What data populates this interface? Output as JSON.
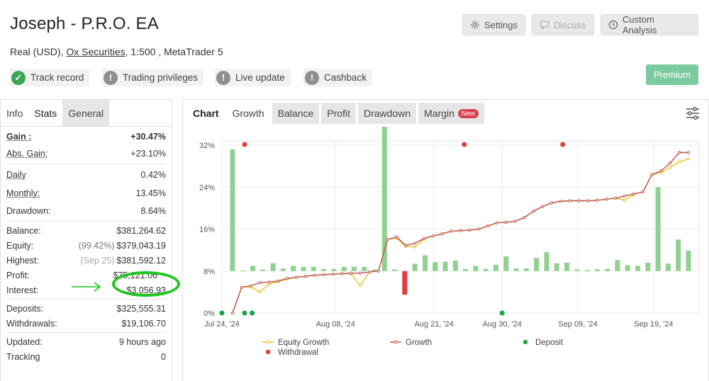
{
  "header": {
    "title": "Joseph - P.R.O. EA",
    "sub_prefix": "Real (USD),",
    "broker": "Ox Securities",
    "sub_suffix": ", 1:500 , MetaTrader 5",
    "settings": "Settings",
    "discuss": "Discuss",
    "custom_analysis": "Custom Analysis",
    "premium": "Premium"
  },
  "badges": {
    "track_record": "Track record",
    "trading_privileges": "Trading privileges",
    "live_update": "Live update",
    "cashback": "Cashback"
  },
  "left_tabs": {
    "info": "Info",
    "stats": "Stats",
    "general": "General"
  },
  "stats": {
    "gain_k": "Gain :",
    "gain_v": "+30.47%",
    "abs_gain_k": "Abs. Gain:",
    "abs_gain_v": "+23.10%",
    "daily_k": "Daily",
    "daily_v": "0.42%",
    "monthly_k": "Monthly:",
    "monthly_v": "13.45%",
    "drawdown_k": "Drawdown:",
    "drawdown_v": "8.64%",
    "balance_k": "Balance:",
    "balance_v": "$381,264.62",
    "equity_k": "Equity:",
    "equity_pre": "(99.42%)",
    "equity_v": "$379,043.19",
    "highest_k": "Highest:",
    "highest_pre": "(Sep 25)",
    "highest_v": "$381,592.12",
    "profit_k": "Profit:",
    "profit_v": "$75,121.06",
    "interest_k": "Interest:",
    "interest_v": "$3,056.93",
    "deposits_k": "Deposits:",
    "deposits_v": "$325,555.31",
    "withdrawals_k": "Withdrawals:",
    "withdrawals_v": "$19,106.70",
    "updated_k": "Updated:",
    "updated_v": "9 hours ago",
    "tracking_k": "Tracking",
    "tracking_v": "0"
  },
  "chart_tabs": {
    "chart": "Chart",
    "growth": "Growth",
    "balance": "Balance",
    "profit": "Profit",
    "drawdown": "Drawdown",
    "margin": "Margin",
    "new": "New"
  },
  "colors": {
    "growth": "#c0504d",
    "equity": "#e8c21a",
    "bar_pos": "#8fd18f",
    "bar_neg": "#e23b3b",
    "deposit": "#1aa34a",
    "withdrawal": "#e03c3c",
    "premium": "#7ccba0"
  },
  "chart_data": {
    "type": "line",
    "x_ticks": [
      "Jul 24, '24",
      "Aug 08, '24",
      "Aug 21, '24",
      "Aug 30, '24",
      "Sep 09, '24",
      "Sep 19, '24"
    ],
    "y_ticks": [
      "0%",
      "8%",
      "16%",
      "24%",
      "32%"
    ],
    "ylim": [
      0,
      32
    ],
    "legend": [
      "Equity Growth",
      "Growth",
      "Deposit",
      "Withdrawal"
    ],
    "growth": [
      0,
      4.9,
      5.2,
      5.8,
      5.9,
      6.1,
      6.6,
      6.8,
      7.0,
      7.2,
      7.3,
      7.4,
      7.5,
      7.6,
      7.6,
      7.8,
      8.0,
      14.0,
      14.5,
      12.9,
      13.3,
      14.2,
      14.7,
      15.1,
      15.6,
      15.7,
      15.8,
      16.0,
      16.6,
      17.2,
      17.3,
      17.5,
      18.2,
      19.4,
      20.3,
      21.0,
      21.3,
      21.4,
      21.4,
      21.4,
      21.5,
      21.7,
      21.9,
      22.3,
      22.7,
      23.1,
      26.4,
      27.1,
      28.6,
      30.6,
      30.6
    ],
    "equity_growth": [
      0,
      4.9,
      5.0,
      4.0,
      5.5,
      6.0,
      6.5,
      6.8,
      7.0,
      7.2,
      7.3,
      7.4,
      7.5,
      7.5,
      5.2,
      7.8,
      8.0,
      14.0,
      14.3,
      12.7,
      12.6,
      14.1,
      14.7,
      15.1,
      15.6,
      15.7,
      15.8,
      16.0,
      16.6,
      17.2,
      17.3,
      17.5,
      18.2,
      19.4,
      20.3,
      21.0,
      21.3,
      21.4,
      21.4,
      21.4,
      21.5,
      21.7,
      21.9,
      21.5,
      22.6,
      23.1,
      26.4,
      26.8,
      27.8,
      28.8,
      29.4
    ],
    "bars": [
      23.2,
      0.1,
      1.0,
      0.3,
      1.5,
      0.5,
      1.0,
      0.8,
      0.8,
      0.4,
      0.4,
      0.8,
      0.8,
      0.8,
      0.3,
      29.2,
      0.3,
      -4.5,
      1.4,
      3.0,
      1.7,
      1.8,
      2.0,
      0.4,
      1.0,
      0.4,
      1.2,
      2.8,
      0.5,
      0.5,
      2.5,
      3.6,
      1.5,
      1.6,
      0.3,
      0.2,
      0.3,
      0.4,
      2.1,
      1.1,
      1.0,
      1.6,
      16.0,
      1.4,
      6.0,
      3.9
    ],
    "deposit_dates": [
      "Jul 24, '24",
      "Jul 27, '24",
      "Jul 28, '24",
      "Aug 30, '24"
    ],
    "withdrawal_dates": [
      "Jul 27, '24",
      "Aug 25, '24",
      "Sep 07, '24"
    ]
  }
}
